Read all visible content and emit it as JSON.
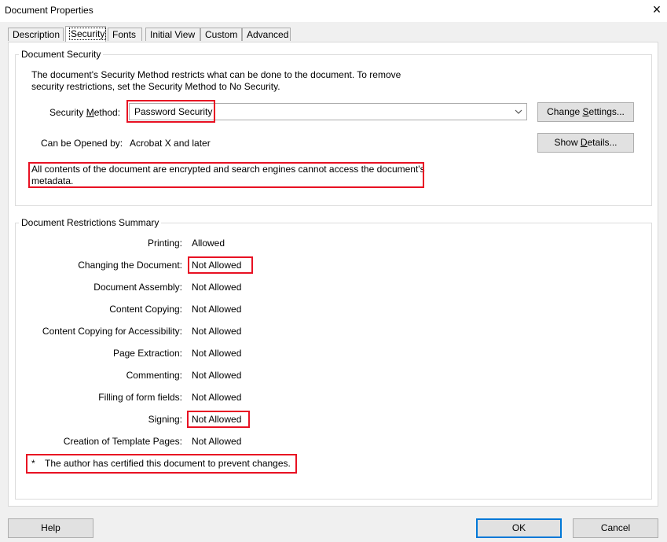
{
  "window": {
    "title": "Document Properties",
    "close_glyph": "×"
  },
  "tabs": [
    {
      "label": "Description"
    },
    {
      "label": "Security"
    },
    {
      "label": "Fonts"
    },
    {
      "label": "Initial View"
    },
    {
      "label": "Custom"
    },
    {
      "label": "Advanced"
    }
  ],
  "security": {
    "group_title": "Document Security",
    "description_line1": "The document's Security Method restricts what can be done to the document. To remove",
    "description_line2": "security restrictions, set the Security Method to No Security.",
    "method_label_pre": "Security ",
    "method_label_ul": "M",
    "method_label_post": "ethod:",
    "method_value": "Password Security",
    "change_pre": "Change ",
    "change_ul": "S",
    "change_post": "ettings...",
    "opened_by_label": "Can be Opened by:",
    "opened_by_value": "Acrobat X and later",
    "show_pre": "Show ",
    "show_ul": "D",
    "show_post": "etails...",
    "encrypt_line1": "All contents of the document are encrypted and search engines cannot access the document's",
    "encrypt_line2": "metadata."
  },
  "restrictions": {
    "group_title": "Document Restrictions Summary",
    "rows": [
      {
        "label": "Printing:",
        "value": "Allowed"
      },
      {
        "label": "Changing the Document:",
        "value": "Not Allowed"
      },
      {
        "label": "Document Assembly:",
        "value": "Not Allowed"
      },
      {
        "label": "Content Copying:",
        "value": "Not Allowed"
      },
      {
        "label": "Content Copying for Accessibility:",
        "value": "Not Allowed"
      },
      {
        "label": "Page Extraction:",
        "value": "Not Allowed"
      },
      {
        "label": "Commenting:",
        "value": "Not Allowed"
      },
      {
        "label": "Filling of form fields:",
        "value": "Not Allowed"
      },
      {
        "label": "Signing:",
        "value": "Not Allowed"
      },
      {
        "label": "Creation of Template Pages:",
        "value": "Not Allowed"
      }
    ],
    "footnote_star": "*",
    "footnote_text": "The author has certified this document to prevent changes."
  },
  "buttons": {
    "help": "Help",
    "ok": "OK",
    "cancel": "Cancel"
  },
  "colors": {
    "highlight": "#e81123",
    "focus_border": "#0078d7"
  }
}
